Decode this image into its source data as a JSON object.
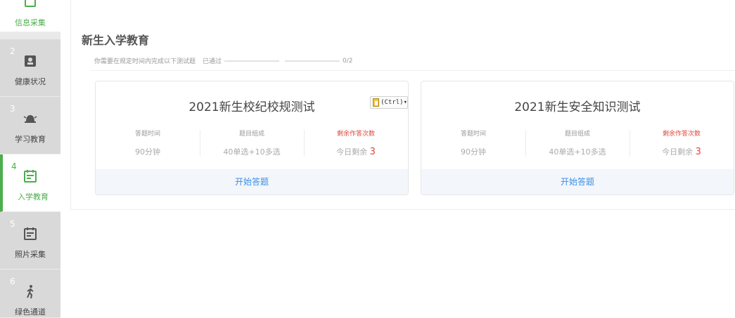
{
  "sidebar": {
    "steps": [
      {
        "num": "",
        "label": "信息采集",
        "icon": "clipboard-icon",
        "state": "done"
      },
      {
        "num": "2",
        "label": "健康状况",
        "icon": "id-card-icon",
        "state": "default"
      },
      {
        "num": "3",
        "label": "学习教育",
        "icon": "bell-icon",
        "state": "default"
      },
      {
        "num": "4",
        "label": "入学教育",
        "icon": "calendar-icon",
        "state": "active"
      },
      {
        "num": "5",
        "label": "照片采集",
        "icon": "calendar-icon",
        "state": "default"
      },
      {
        "num": "6",
        "label": "绿色通道",
        "icon": "walking-person-icon",
        "state": "default"
      }
    ]
  },
  "main": {
    "title": "新生入学教育",
    "instruction": "你需要在规定时间内完成以下测试题",
    "passed_label": "已通过",
    "progress_text": "0/2",
    "progress_fraction": 0
  },
  "cards": [
    {
      "title": "2021新生校纪校规测试",
      "stats": [
        {
          "key": "答题时间",
          "value": "90分钟"
        },
        {
          "key": "题目组成",
          "value": "40单选+10多选"
        },
        {
          "key": "剩余作答次数",
          "value_prefix": "今日剩余",
          "count": "3"
        }
      ],
      "action": "开始答题"
    },
    {
      "title": "2021新生安全知识测试",
      "stats": [
        {
          "key": "答题时间",
          "value": "90分钟"
        },
        {
          "key": "题目组成",
          "value": "40单选+10多选"
        },
        {
          "key": "剩余作答次数",
          "value_prefix": "今日剩余",
          "count": "3"
        }
      ],
      "action": "开始答题"
    }
  ],
  "paste_popup": {
    "label": "(Ctrl)▾",
    "icon": "clipboard-paste-icon"
  },
  "colors": {
    "accent_green": "#4cae4c",
    "link_blue": "#3a8ee6",
    "danger_red": "#e0473c"
  }
}
